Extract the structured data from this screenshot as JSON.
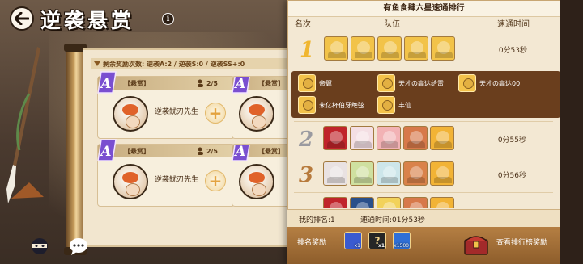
{
  "header": {
    "title": "逆袭悬赏",
    "info_glyph": "i"
  },
  "left_scroll": {
    "reward_count_text": "剩余奖励次数: 逆袭A:2 / 逆袭S:0 / 逆袭SS+:0",
    "cards": [
      {
        "tag": "【悬赏】",
        "count": "2/5",
        "boss": "逆袭鱿刃先生",
        "grade": "A"
      },
      {
        "tag": "【悬赏】",
        "count": "",
        "boss": "",
        "grade": "A"
      },
      {
        "tag": "【悬赏】",
        "count": "2/5",
        "boss": "逆袭鱿刃先生",
        "grade": "A"
      },
      {
        "tag": "【悬赏】",
        "count": "",
        "boss": "",
        "grade": "A"
      }
    ],
    "plus_glyph": "+"
  },
  "ranking": {
    "title": "有鱼食肆六星速通排行",
    "columns": {
      "rank": "名次",
      "team": "队伍",
      "time": "速通时间"
    },
    "rows": [
      {
        "rank": "1",
        "time": "0分53秒",
        "rank_color": "#f0b630",
        "avatars": [
          "#f2c349",
          "#f2c349",
          "#f2c349",
          "#f2c349",
          "#f2c349"
        ]
      },
      {
        "rank": "2",
        "time": "0分55秒",
        "rank_color": "#9a9aa0",
        "avatars": [
          "#c0242a",
          "#f4dfe4",
          "#f2b2b5",
          "#d7794a",
          "#f2b335"
        ]
      },
      {
        "rank": "3",
        "time": "0分56秒",
        "rank_color": "#b77a3c",
        "avatars": [
          "#e9e2e2",
          "#cfe0a0",
          "#cde6ea",
          "#d9824a",
          "#f2b335"
        ]
      }
    ],
    "expanded_members": [
      {
        "name": "帝翼"
      },
      {
        "name": "天才の高达给雷"
      },
      {
        "name": "天才の高达00"
      },
      {
        "name": "未亿杯伯牙绝弦"
      },
      {
        "name": "丰仙"
      }
    ],
    "my_rank_label": "我的排名:1",
    "my_time_label": "速通时间:01分53秒",
    "footer": {
      "reward_label": "排名奖励",
      "rewards": [
        {
          "qty": "x1",
          "color": "#3a5bd1"
        },
        {
          "qty": "x1",
          "color": "#262626",
          "glyph": "?"
        },
        {
          "qty": "x1500",
          "color": "#2f6fd6"
        }
      ],
      "view_label": "查看排行榜奖励"
    }
  }
}
